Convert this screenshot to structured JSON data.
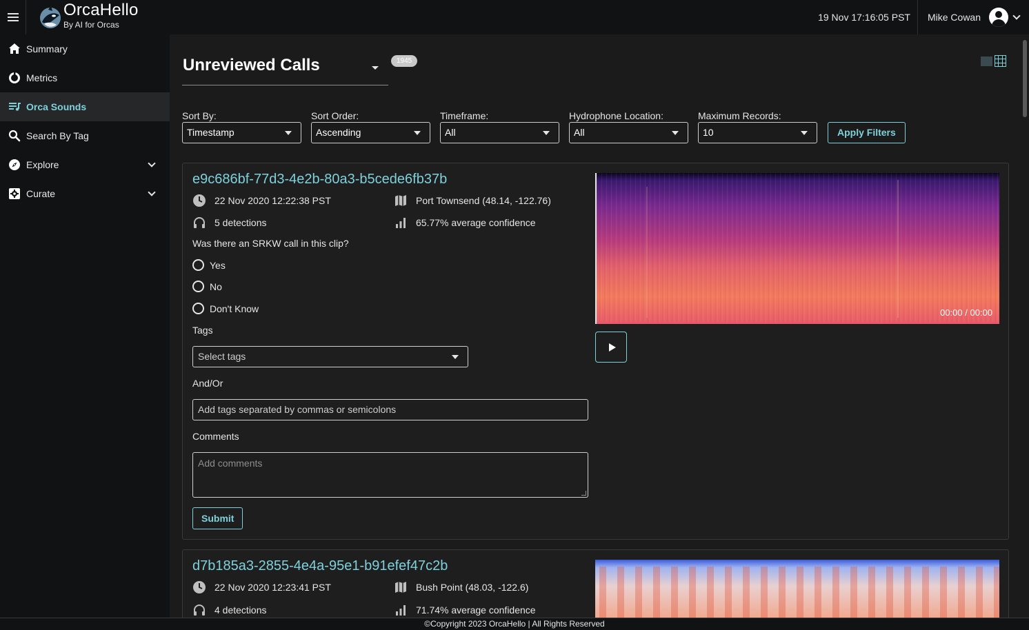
{
  "header": {
    "brand_title": "OrcaHello",
    "brand_subtitle": "By AI for Orcas",
    "clock": "19 Nov 17:16:05 PST",
    "user_name": "Mike Cowan"
  },
  "sidebar": {
    "items": [
      {
        "label": "Summary",
        "icon": "home-icon"
      },
      {
        "label": "Metrics",
        "icon": "pie-chart-icon"
      },
      {
        "label": "Orca Sounds",
        "icon": "playlist-icon",
        "active": true
      },
      {
        "label": "Search By Tag",
        "icon": "search-icon"
      },
      {
        "label": "Explore",
        "icon": "compass-icon",
        "expandable": true
      },
      {
        "label": "Curate",
        "icon": "settings-box-icon",
        "expandable": true
      }
    ]
  },
  "main": {
    "title": "Unreviewed Calls",
    "count_badge": "1945",
    "filters": {
      "sort_by": {
        "label": "Sort By:",
        "value": "Timestamp"
      },
      "sort_order": {
        "label": "Sort Order:",
        "value": "Ascending"
      },
      "timeframe": {
        "label": "Timeframe:",
        "value": "All"
      },
      "hydrophone": {
        "label": "Hydrophone Location:",
        "value": "All"
      },
      "max_records": {
        "label": "Maximum Records:",
        "value": "10"
      },
      "apply_label": "Apply Filters"
    },
    "cards": [
      {
        "id": "e9c686bf-77d3-4e2b-80a3-b5cede6fb37b",
        "timestamp": "22 Nov 2020 12:22:38 PST",
        "location": "Port Townsend (48.14, -122.76)",
        "detections": "5 detections",
        "confidence": "65.77% average confidence",
        "question": "Was there an SRKW call in this clip?",
        "options": [
          "Yes",
          "No",
          "Don't Know"
        ],
        "tags_label": "Tags",
        "tags_placeholder": "Select tags",
        "andor_label": "And/Or",
        "andor_placeholder": "Add tags separated by commas or semicolons",
        "comments_label": "Comments",
        "comments_placeholder": "Add comments",
        "submit_label": "Submit",
        "player_time": "00:00 / 00:00"
      },
      {
        "id": "d7b185a3-2855-4e4a-95e1-b91efef47c2b",
        "timestamp": "22 Nov 2020 12:23:41 PST",
        "location": "Bush Point (48.03, -122.6)",
        "detections": "4 detections",
        "confidence": "71.74% average confidence"
      }
    ]
  },
  "footer": {
    "text": "©Copyright 2023 OrcaHello | All Rights Reserved"
  },
  "colors": {
    "accent": "#7fd1dc",
    "background": "#1b1b1b",
    "sidebar_bg": "#111214"
  }
}
